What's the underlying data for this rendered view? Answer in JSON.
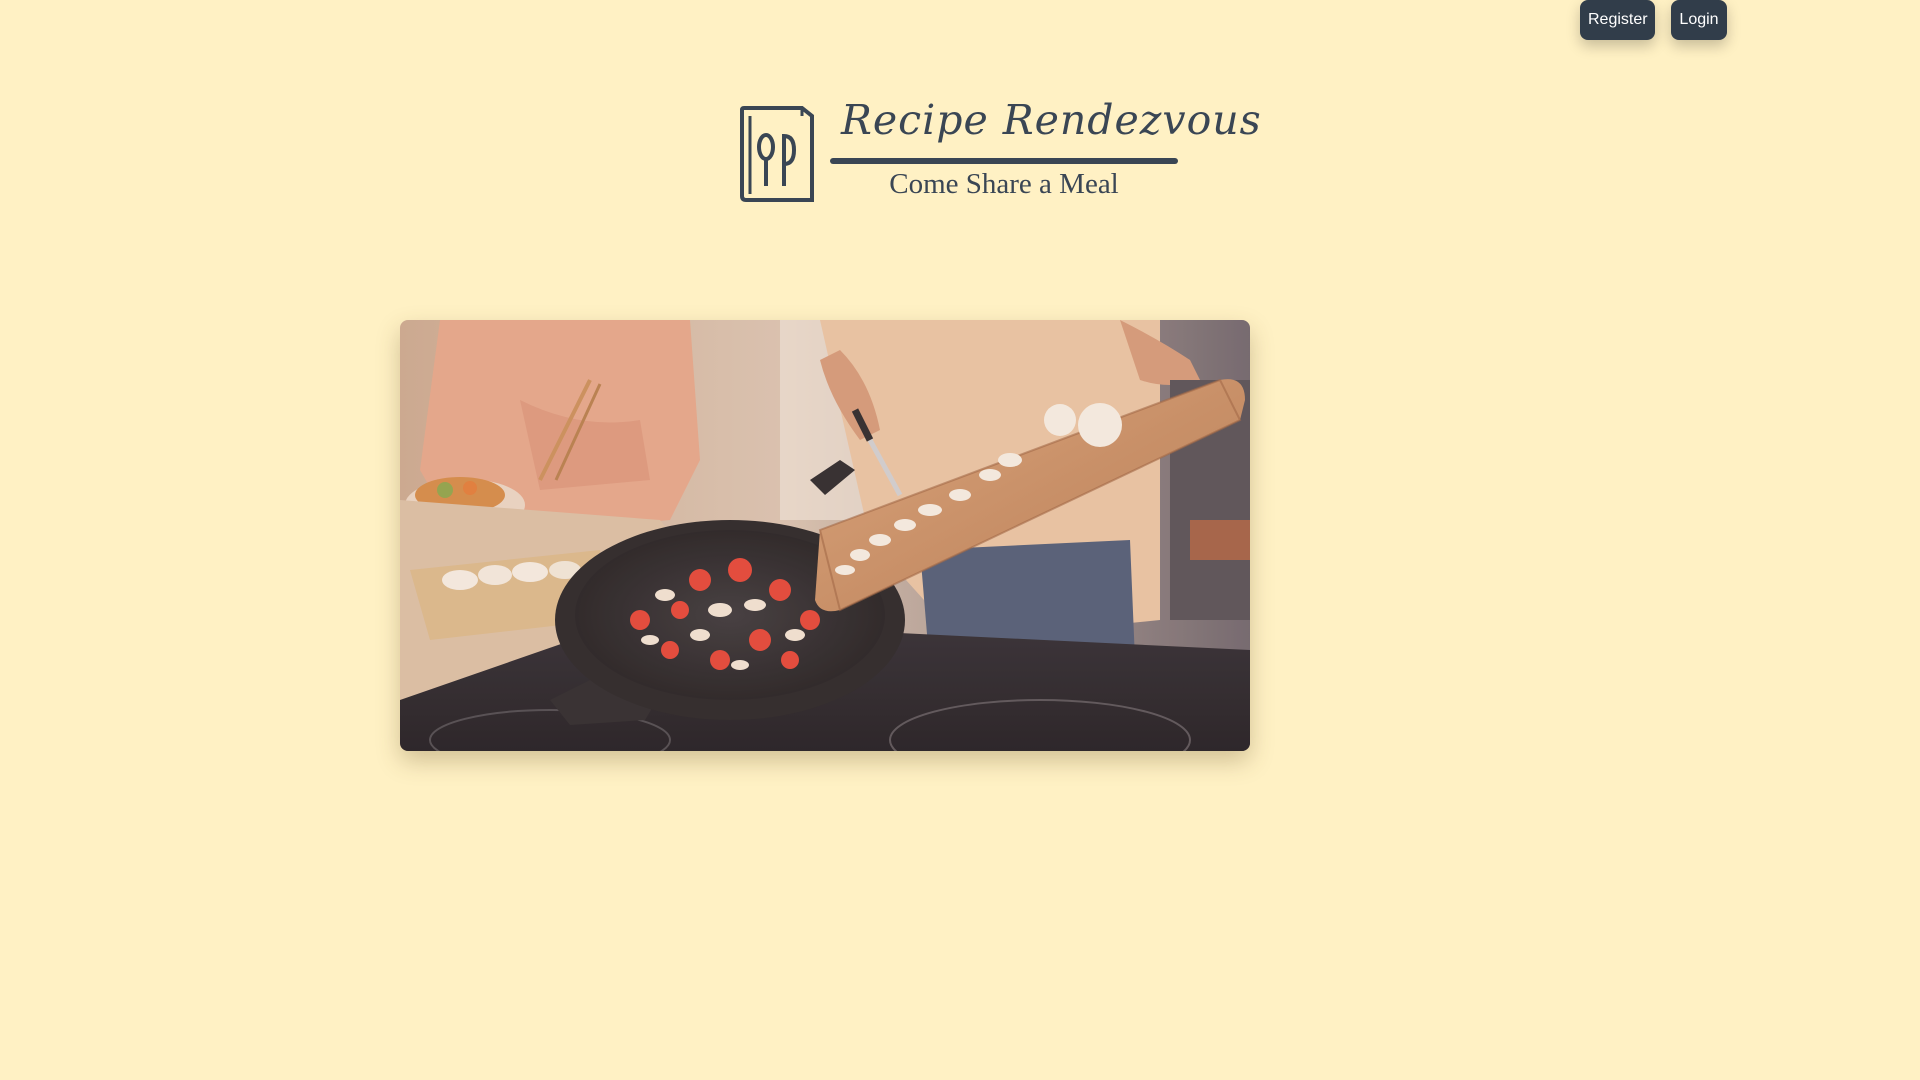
{
  "nav": {
    "register_label": "Register",
    "login_label": "Login"
  },
  "brand": {
    "title": "Recipe Rendezvous",
    "tagline": "Come Share a Meal",
    "logo_icon": "cookbook-utensils-icon"
  },
  "hero": {
    "image": "cooking-scene-photo"
  },
  "colors": {
    "background": "#fff1c4",
    "button_bg": "#313d4a",
    "button_text": "#ffffff",
    "brand_ink": "#3a4654"
  }
}
